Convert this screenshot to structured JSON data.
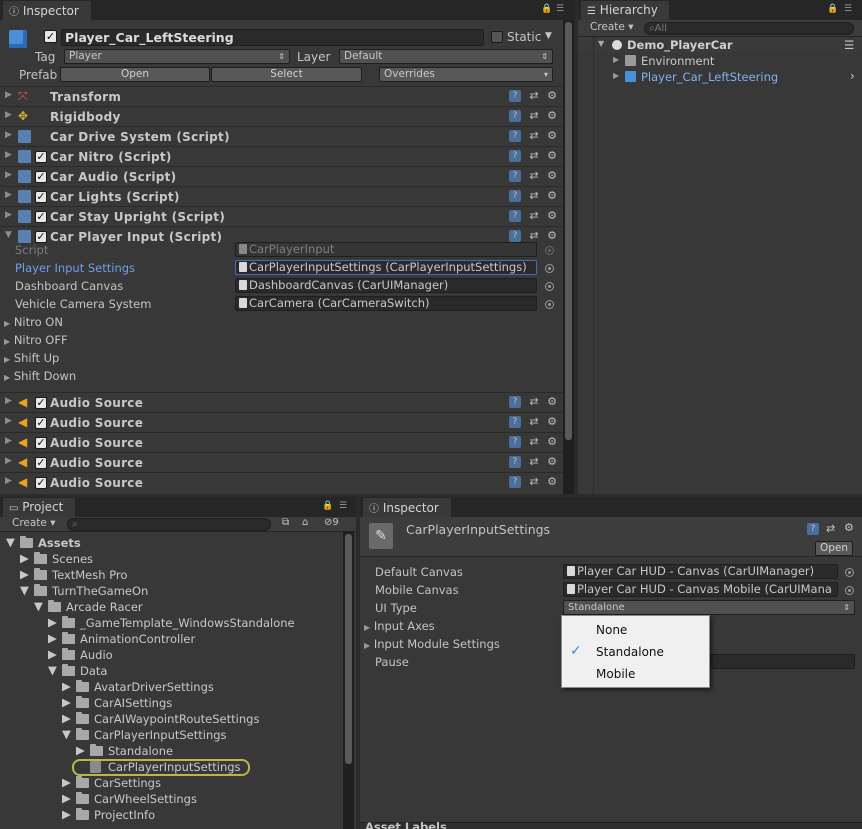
{
  "inspector": {
    "tab": "Inspector",
    "object_name": "Player_Car_LeftSteering",
    "static_label": "Static",
    "tag_label": "Tag",
    "tag_value": "Player",
    "layer_label": "Layer",
    "layer_value": "Default",
    "prefab_label": "Prefab",
    "open_label": "Open",
    "select_label": "Select",
    "overrides_label": "Overrides",
    "components": [
      "Transform",
      "Rigidbody",
      "Car Drive System (Script)",
      "Car Nitro (Script)",
      "Car Audio (Script)",
      "Car Lights (Script)",
      "Car Stay Upright (Script)",
      "Car Player Input (Script)"
    ],
    "script_label": "Script",
    "script_value": "CarPlayerInput",
    "player_input_settings_label": "Player Input Settings",
    "player_input_settings_value": "CarPlayerInputSettings (CarPlayerInputSettings)",
    "dashboard_canvas_label": "Dashboard Canvas",
    "dashboard_canvas_value": "DashboardCanvas (CarUIManager)",
    "vehicle_camera_label": "Vehicle Camera System",
    "vehicle_camera_value": "CarCamera (CarCameraSwitch)",
    "events": [
      "Nitro ON",
      "Nitro OFF",
      "Shift Up",
      "Shift Down"
    ],
    "audio_sources": [
      "Audio Source",
      "Audio Source",
      "Audio Source",
      "Audio Source",
      "Audio Source"
    ]
  },
  "hierarchy": {
    "tab": "Hierarchy",
    "create_label": "Create",
    "search_placeholder": "All",
    "scene": "Demo_PlayerCar",
    "items": [
      "Environment",
      "Player_Car_LeftSteering"
    ]
  },
  "project": {
    "tab": "Project",
    "create_label": "Create",
    "hidden_count": "9",
    "tree": [
      "Assets",
      "Scenes",
      "TextMesh Pro",
      "TurnTheGameOn",
      "Arcade Racer",
      "_GameTemplate_WindowsStandalone",
      "AnimationController",
      "Audio",
      "Data",
      "AvatarDriverSettings",
      "CarAISettings",
      "CarAIWaypointRouteSettings",
      "CarPlayerInputSettings",
      "Standalone",
      "CarPlayerInputSettings",
      "CarSettings",
      "CarWheelSettings",
      "ProjectInfo"
    ]
  },
  "inspector2": {
    "tab": "Inspector",
    "asset_title": "CarPlayerInputSettings",
    "open_label": "Open",
    "default_canvas_label": "Default Canvas",
    "default_canvas_value": "Player Car HUD - Canvas (CarUIManager)",
    "mobile_canvas_label": "Mobile Canvas",
    "mobile_canvas_value": "Player Car HUD - Canvas Mobile (CarUIMana",
    "ui_type_label": "UI Type",
    "ui_type_value": "Standalone",
    "input_axes_label": "Input Axes",
    "input_module_label": "Input Module Settings",
    "pause_label": "Pause",
    "asset_labels": "Asset Labels",
    "dropdown_options": [
      "None",
      "Standalone",
      "Mobile"
    ],
    "dropdown_selected": "Standalone"
  }
}
